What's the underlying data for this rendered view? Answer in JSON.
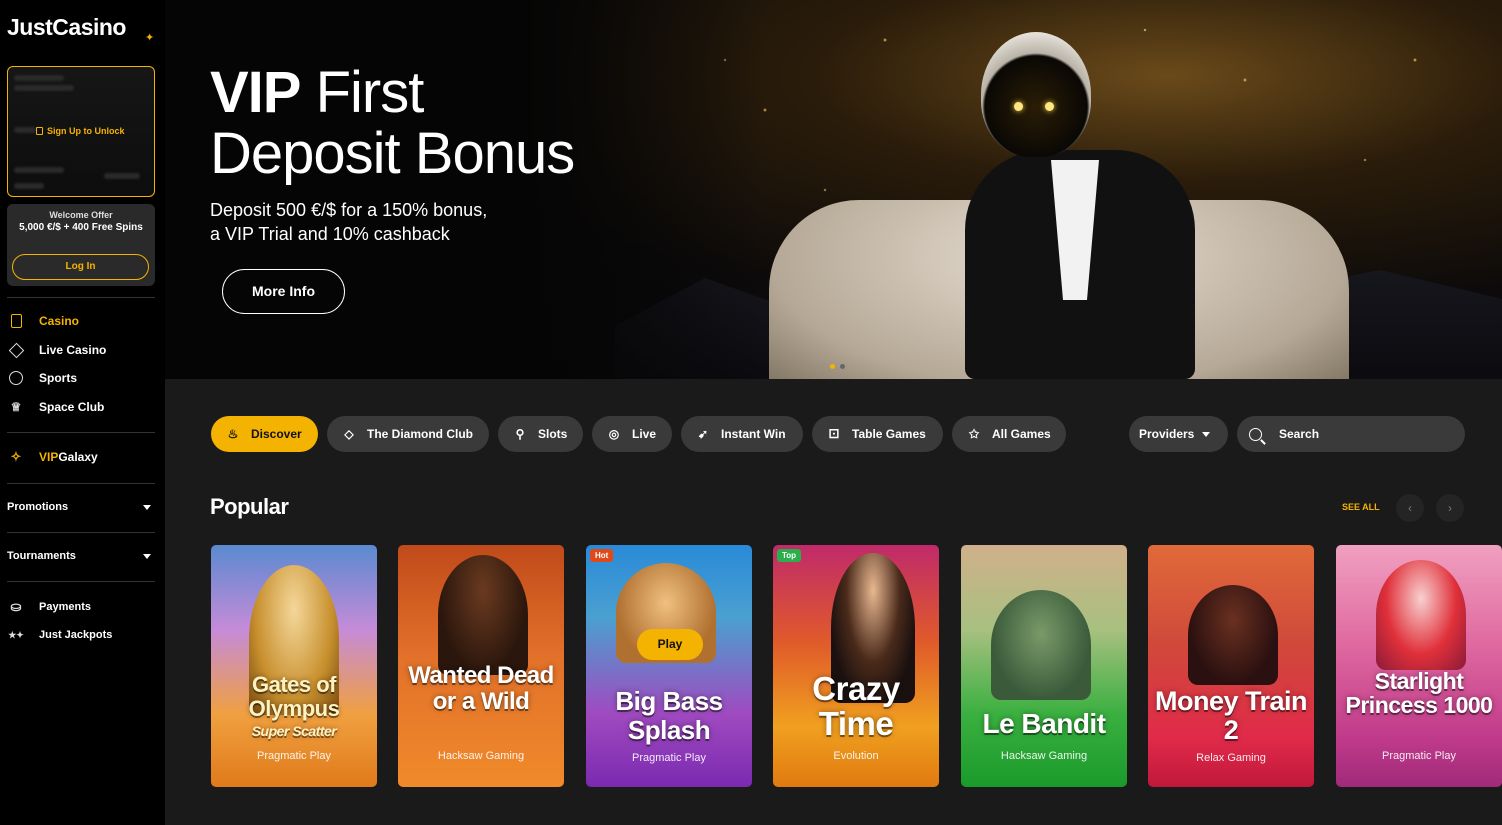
{
  "brand": {
    "name": "JustCasino",
    "accent": "#f5b301"
  },
  "locked_card": {
    "unlock_label": "Sign Up to Unlock"
  },
  "welcome_offer": {
    "title": "Welcome Offer",
    "text": "5,000 €/$ + 400 Free Spins",
    "login_label": "Log In"
  },
  "nav": {
    "primary": [
      {
        "label": "Casino",
        "icon": "casino-icon",
        "active": true
      },
      {
        "label": "Live Casino",
        "icon": "diamond-icon",
        "active": false
      },
      {
        "label": "Sports",
        "icon": "sports-ball-icon",
        "active": false
      },
      {
        "label": "Space Club",
        "icon": "crown-icon",
        "active": false
      }
    ],
    "vip": {
      "label_a": "VIP",
      "label_b": " Galaxy",
      "icon": "sparkle-icon"
    },
    "promotions": "Promotions",
    "tournaments": "Tournaments",
    "secondary": [
      {
        "label": "Payments",
        "icon": "coins-icon"
      },
      {
        "label": "Just Jackpots",
        "icon": "stars-icon"
      }
    ]
  },
  "hero": {
    "title_bold": "VIP",
    "title_rest": " First",
    "title_line2": "Deposit Bonus",
    "subtitle_line1": "Deposit 500 €/$ for a 150% bonus,",
    "subtitle_line2": "a VIP Trial and 10% cashback",
    "button": "More Info"
  },
  "filters": {
    "chips": [
      "Discover",
      "The Diamond Club",
      "Slots",
      "Live",
      "Instant Win",
      "Table Games",
      "All Games"
    ],
    "providers": "Providers",
    "search_placeholder": "Search"
  },
  "popular": {
    "title": "Popular",
    "see_all": "SEE ALL",
    "games": [
      {
        "title": "Gates of Olympus",
        "subtitle": "Super Scatter",
        "provider": "Pragmatic Play",
        "tag": ""
      },
      {
        "title": "Wanted Dead or a Wild",
        "subtitle": "",
        "provider": "Hacksaw Gaming",
        "tag": ""
      },
      {
        "title": "Big Bass Splash",
        "subtitle": "",
        "provider": "Pragmatic Play",
        "tag": "Hot",
        "hover_label": "Play"
      },
      {
        "title": "Crazy Time",
        "subtitle": "",
        "provider": "Evolution",
        "tag": "Top"
      },
      {
        "title": "Le Bandit",
        "subtitle": "",
        "provider": "Hacksaw Gaming",
        "tag": ""
      },
      {
        "title": "Money Train 2",
        "subtitle": "",
        "provider": "Relax Gaming",
        "tag": ""
      },
      {
        "title": "Starlight Princess 1000",
        "subtitle": "",
        "provider": "Pragmatic Play",
        "tag": ""
      }
    ]
  }
}
